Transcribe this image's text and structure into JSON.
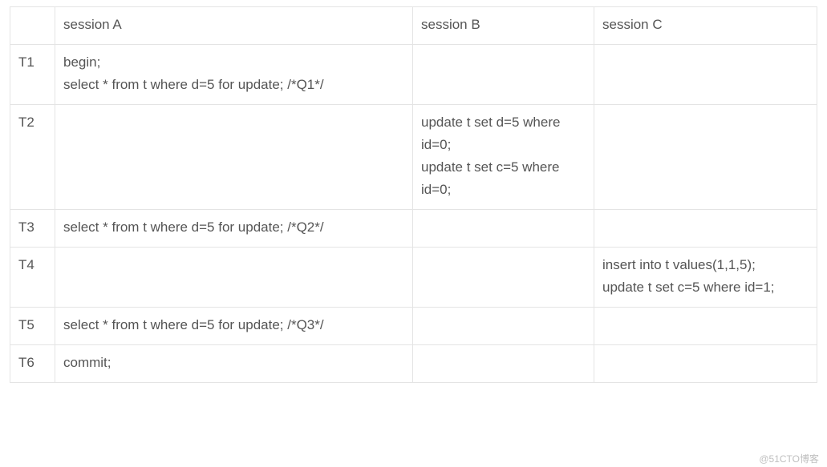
{
  "headers": {
    "c0": "",
    "c1": "session A",
    "c2": "session B",
    "c3": "session C"
  },
  "rows": {
    "r1": {
      "t": "T1",
      "a_l1": "begin;",
      "a_l2": "select * from t where d=5 for update; /*Q1*/",
      "b": "",
      "c": ""
    },
    "r2": {
      "t": "T2",
      "a": "",
      "b_l1": "update t set d=5 where id=0;",
      "b_l2": "update t set c=5 where id=0;",
      "c": ""
    },
    "r3": {
      "t": "T3",
      "a": "select * from t where d=5 for update; /*Q2*/",
      "b": "",
      "c": ""
    },
    "r4": {
      "t": "T4",
      "a": "",
      "b": "",
      "c_l1": "insert into t values(1,1,5);",
      "c_l2": "update t set c=5 where id=1;"
    },
    "r5": {
      "t": "T5",
      "a": "select * from t where d=5 for update; /*Q3*/",
      "b": "",
      "c": ""
    },
    "r6": {
      "t": "T6",
      "a": "commit;",
      "b": "",
      "c": ""
    }
  },
  "watermark": "@51CTO博客"
}
